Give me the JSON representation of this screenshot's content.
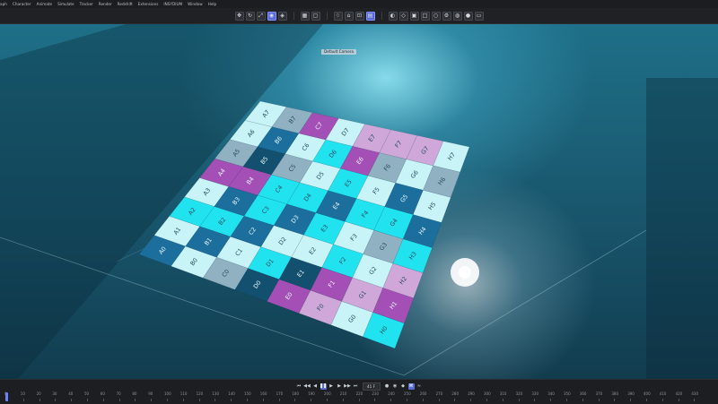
{
  "menu": [
    "aph",
    "Character",
    "Animate",
    "Simulate",
    "Tracker",
    "Render",
    "Redshift",
    "Extensions",
    "INSYDIUM",
    "Window",
    "Help"
  ],
  "toolbar_icons": [
    "move",
    "rotate",
    "scale",
    "object-active",
    "object",
    "render-view",
    "preview",
    "picture-viewer",
    "light-bulb",
    "camera",
    "deformer",
    "material",
    "interactive-render",
    "snap",
    "grid",
    "cube",
    "sphere",
    "settings"
  ],
  "viewport": {
    "camera_label": "Default Camera",
    "colors": {
      "teal_light": "#c8f3f7",
      "cyan": "#21e3f0",
      "blue": "#1c6e9c",
      "magenta": "#a44fb5",
      "lilac": "#cfa7d8",
      "grey_blue": "#8fb1c2",
      "deep_blue": "#13506f"
    },
    "board": {
      "rows": [
        "A",
        "B",
        "C",
        "D",
        "E",
        "F",
        "G",
        "H"
      ],
      "cols": [
        "0",
        "1",
        "2",
        "3",
        "4",
        "5",
        "6",
        "7"
      ],
      "pattern": [
        [
          "blue",
          "teal_light",
          "cyan",
          "teal_light",
          "magenta",
          "grey_blue",
          "teal_light",
          "teal_light"
        ],
        [
          "teal_light",
          "blue",
          "cyan",
          "blue",
          "magenta",
          "deep_blue",
          "blue",
          "grey_blue"
        ],
        [
          "grey_blue",
          "teal_light",
          "blue",
          "cyan",
          "cyan",
          "grey_blue",
          "teal_light",
          "magenta"
        ],
        [
          "deep_blue",
          "cyan",
          "teal_light",
          "blue",
          "cyan",
          "teal_light",
          "cyan",
          "teal_light"
        ],
        [
          "magenta",
          "deep_blue",
          "teal_light",
          "cyan",
          "blue",
          "cyan",
          "magenta",
          "lilac"
        ],
        [
          "lilac",
          "magenta",
          "cyan",
          "teal_light",
          "cyan",
          "teal_light",
          "grey_blue",
          "lilac"
        ],
        [
          "teal_light",
          "lilac",
          "teal_light",
          "grey_blue",
          "cyan",
          "blue",
          "teal_light",
          "lilac"
        ],
        [
          "cyan",
          "magenta",
          "lilac",
          "cyan",
          "blue",
          "teal_light",
          "grey_blue",
          "teal_light"
        ]
      ]
    }
  },
  "timeline": {
    "current_frame": "41 F",
    "ticks": [
      "0",
      "10",
      "20",
      "30",
      "40",
      "50",
      "60",
      "70",
      "80",
      "90",
      "100",
      "110",
      "120",
      "130",
      "140",
      "150",
      "160",
      "170",
      "180",
      "190",
      "200",
      "210",
      "220",
      "230",
      "240",
      "250",
      "260",
      "270",
      "280",
      "290",
      "300",
      "310",
      "320",
      "330",
      "340",
      "350",
      "360",
      "370",
      "380",
      "390",
      "400",
      "410",
      "420",
      "430"
    ],
    "transport": [
      "go-start",
      "prev-key",
      "prev-frame",
      "play-back",
      "pause",
      "play",
      "next-frame",
      "next-key",
      "go-end"
    ]
  }
}
